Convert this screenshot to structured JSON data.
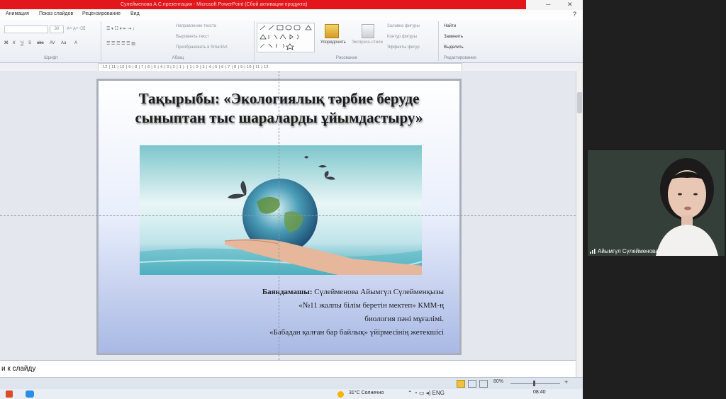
{
  "window": {
    "title": "Сулейменова А.С.презентация - Microsoft PowerPoint (Сбой активации продукта)"
  },
  "menu": {
    "tabs": [
      "Анимация",
      "Показ слайдов",
      "Рецензирование",
      "Вид"
    ]
  },
  "ribbon": {
    "groups": {
      "font": "Шрифт",
      "paragraph": "Абзац",
      "drawing": "Рисование",
      "editing": "Редактирование"
    },
    "font_size": "30",
    "paragraph_buttons": [
      "Направление текста",
      "Выровнять текст",
      "Преобразовать в SmartArt"
    ],
    "arrange": "Упорядочить",
    "quick_styles": "Экспресс-стили",
    "shape_fill": "Заливка фигуры",
    "shape_outline": "Контур фигуры",
    "shape_effects": "Эффекты фигур",
    "find": "Найти",
    "replace": "Заменить",
    "select": "Выделить"
  },
  "ruler": {
    "text": "·12·|·11·|·10·|·9·|·8·|·7·|·6·|·5·|·4·|·3·|·2·|·1·|··|·1·|·2·|·3·|·4·|·5·|·6·|·7·|·8·|·9·|·10·|·11·|·12·"
  },
  "slide": {
    "title_line1": "Тақырыбы: «Экологиялық тәрбие беруде",
    "title_line2": "сыныптан тыс шараларды ұйымдастыру»",
    "author_label": "Баяндамашы:",
    "author_name": " Сүлейменова Айымгүл  Сүлейменқызы",
    "author_line2": "«№11 жалпы білім беретін мектеп» КММ-ң",
    "author_line3": "биология пәні мұғалімі.",
    "author_line4": "«Бабадан қалған бар байлық» үйірмесінің жетекшісі"
  },
  "notes": {
    "placeholder": "и к слайду"
  },
  "status": {
    "zoom": "80%"
  },
  "taskbar": {
    "weather": "31°C  Солнечно",
    "time": "08:40"
  },
  "video": {
    "participant_name": "Айымгүл Сүлейменова"
  }
}
